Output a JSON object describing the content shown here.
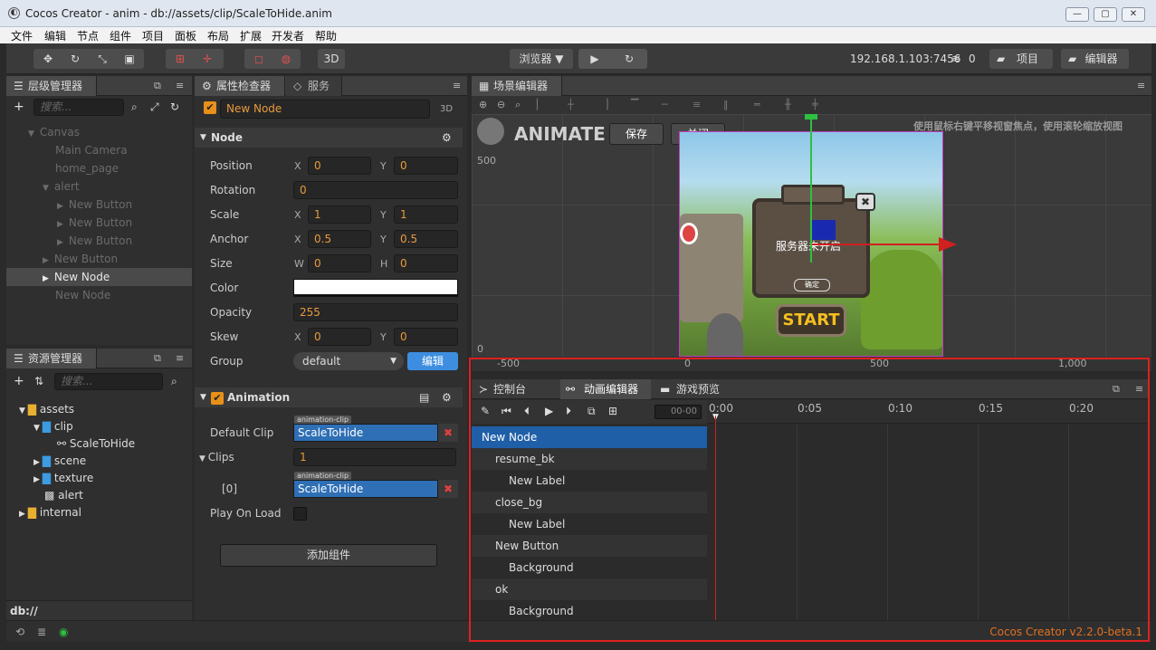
{
  "window": {
    "title": "Cocos Creator - anim - db://assets/clip/ScaleToHide.anim",
    "minimize": "—",
    "maximize": "▢",
    "close": "✕"
  },
  "menu": [
    "文件",
    "编辑",
    "节点",
    "组件",
    "项目",
    "面板",
    "布局",
    "扩展",
    "开发者",
    "帮助"
  ],
  "toolbar": {
    "btn_3d": "3D",
    "preview_select": "浏览器 ▼",
    "ip": "192.168.1.103:7456",
    "count": "0",
    "project_btn": "项目",
    "editor_btn": "编辑器"
  },
  "hierarchy": {
    "title": "层级管理器",
    "search_placeholder": "搜索...",
    "items": [
      "Canvas",
      "Main Camera",
      "home_page",
      "alert",
      "New Button",
      "New Button",
      "New Button",
      "New Button",
      "New Node",
      "New Node"
    ]
  },
  "assets": {
    "title": "资源管理器",
    "search_placeholder": "搜索...",
    "items": [
      "assets",
      "clip",
      "ScaleToHide",
      "scene",
      "texture",
      "alert",
      "internal"
    ],
    "path": "db://"
  },
  "inspector": {
    "tab1": "属性检查器",
    "tab2": "服务",
    "node_name": "New Node",
    "badge_3d": "3D",
    "node_section": "Node",
    "labels": {
      "position": "Position",
      "rotation": "Rotation",
      "scale": "Scale",
      "anchor": "Anchor",
      "size": "Size",
      "color": "Color",
      "opacity": "Opacity",
      "skew": "Skew",
      "group": "Group"
    },
    "axes": {
      "x": "X",
      "y": "Y",
      "w": "W",
      "h": "H"
    },
    "position": {
      "x": "0",
      "y": "0"
    },
    "rotation": "0",
    "scale": {
      "x": "1",
      "y": "1"
    },
    "anchor": {
      "x": "0.5",
      "y": "0.5"
    },
    "size": {
      "w": "0",
      "h": "0"
    },
    "opacity": "255",
    "skew": {
      "x": "0",
      "y": "0"
    },
    "group": "default",
    "group_edit": "编辑",
    "anim_section": "Animation",
    "clip_tag": "animation-clip",
    "default_clip_label": "Default Clip",
    "default_clip": "ScaleToHide",
    "clips_label": "Clips",
    "clips_count": "1",
    "clip0_label": "[0]",
    "clip0": "ScaleToHide",
    "play_on_load": "Play On Load",
    "add_component": "添加组件"
  },
  "scene": {
    "title": "场景编辑器",
    "animate_label": "ANIMATE",
    "save": "保存",
    "close": "关闭",
    "hint": "使用鼠标右键平移视窗焦点，使用滚轮缩放视图",
    "ruler_y": [
      "500",
      "0"
    ],
    "ruler_x": [
      "-500",
      "0",
      "500",
      "1,000"
    ],
    "dialog_text": "服务器未开启",
    "dialog_ok": "确定",
    "start": "START"
  },
  "bottom": {
    "tabs": [
      "控制台",
      "动画编辑器",
      "游戏预览"
    ],
    "frame": "00-00",
    "timeline": [
      "0:00",
      "0:05",
      "0:10",
      "0:15",
      "0:20"
    ],
    "tracks": [
      "New Node",
      "resume_bk",
      "New Label",
      "close_bg",
      "New Label",
      "New Button",
      "Background",
      "ok",
      "Background"
    ],
    "version": "Cocos Creator v2.2.0-beta.1"
  },
  "colors": {
    "accent": "#e89a3c",
    "selection": "#1f5fa8",
    "highlight_border": "#e02020",
    "playhead": "#cc2222"
  }
}
